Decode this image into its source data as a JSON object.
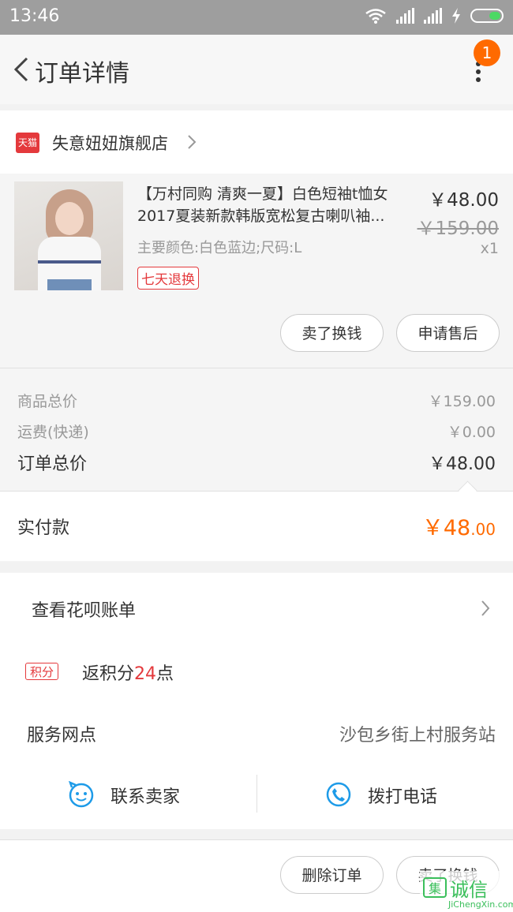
{
  "status_bar": {
    "time": "13:46"
  },
  "header": {
    "title": "订单详情",
    "badge": "1"
  },
  "shop": {
    "tmall_label": "天猫",
    "name": "失意妞妞旗舰店"
  },
  "product": {
    "title_line1": "【万村同购 清爽一夏】白色短袖t恤女",
    "title_line2": "2017夏装新款韩版宽松复古喇叭袖...",
    "spec": "主要颜色:白色蓝边;尺码:L",
    "tag": "七天退换",
    "price": "￥48.00",
    "original_price": "￥159.00",
    "quantity": "x1",
    "sell_button": "卖了换钱",
    "after_sale_button": "申请售后"
  },
  "totals": {
    "goods_label": "商品总价",
    "goods_value": "￥159.00",
    "shipping_label": "运费(快递)",
    "shipping_value": "￥0.00",
    "order_label": "订单总价",
    "order_value": "￥48.00",
    "paid_label": "实付款",
    "paid_currency": "￥",
    "paid_int": "48",
    "paid_dec": ".00"
  },
  "services": {
    "huabei": "查看花呗账单",
    "points_icon": "积分",
    "points_prefix": "返积分",
    "points_num": "24",
    "points_suffix": "点",
    "station_label": "服务网点",
    "station_value": "沙包乡街上村服务站",
    "contact_seller": "联系卖家",
    "call_phone": "拨打电话"
  },
  "bottom": {
    "delete_button": "删除订单",
    "sell_button": "卖了换钱"
  },
  "watermark": {
    "logo": "集",
    "name": "诚信",
    "url": "JiChengXin.com"
  },
  "icons": [
    "wifi-icon",
    "signal-icon",
    "charging-icon",
    "battery-icon",
    "back-icon",
    "more-icon",
    "tmall-icon",
    "chevron-right-icon",
    "smile-chat-icon",
    "phone-icon"
  ],
  "colors": {
    "accent_orange": "#ff6a00",
    "tmall_red": "#e4393c",
    "link_blue": "#1e9be8"
  }
}
